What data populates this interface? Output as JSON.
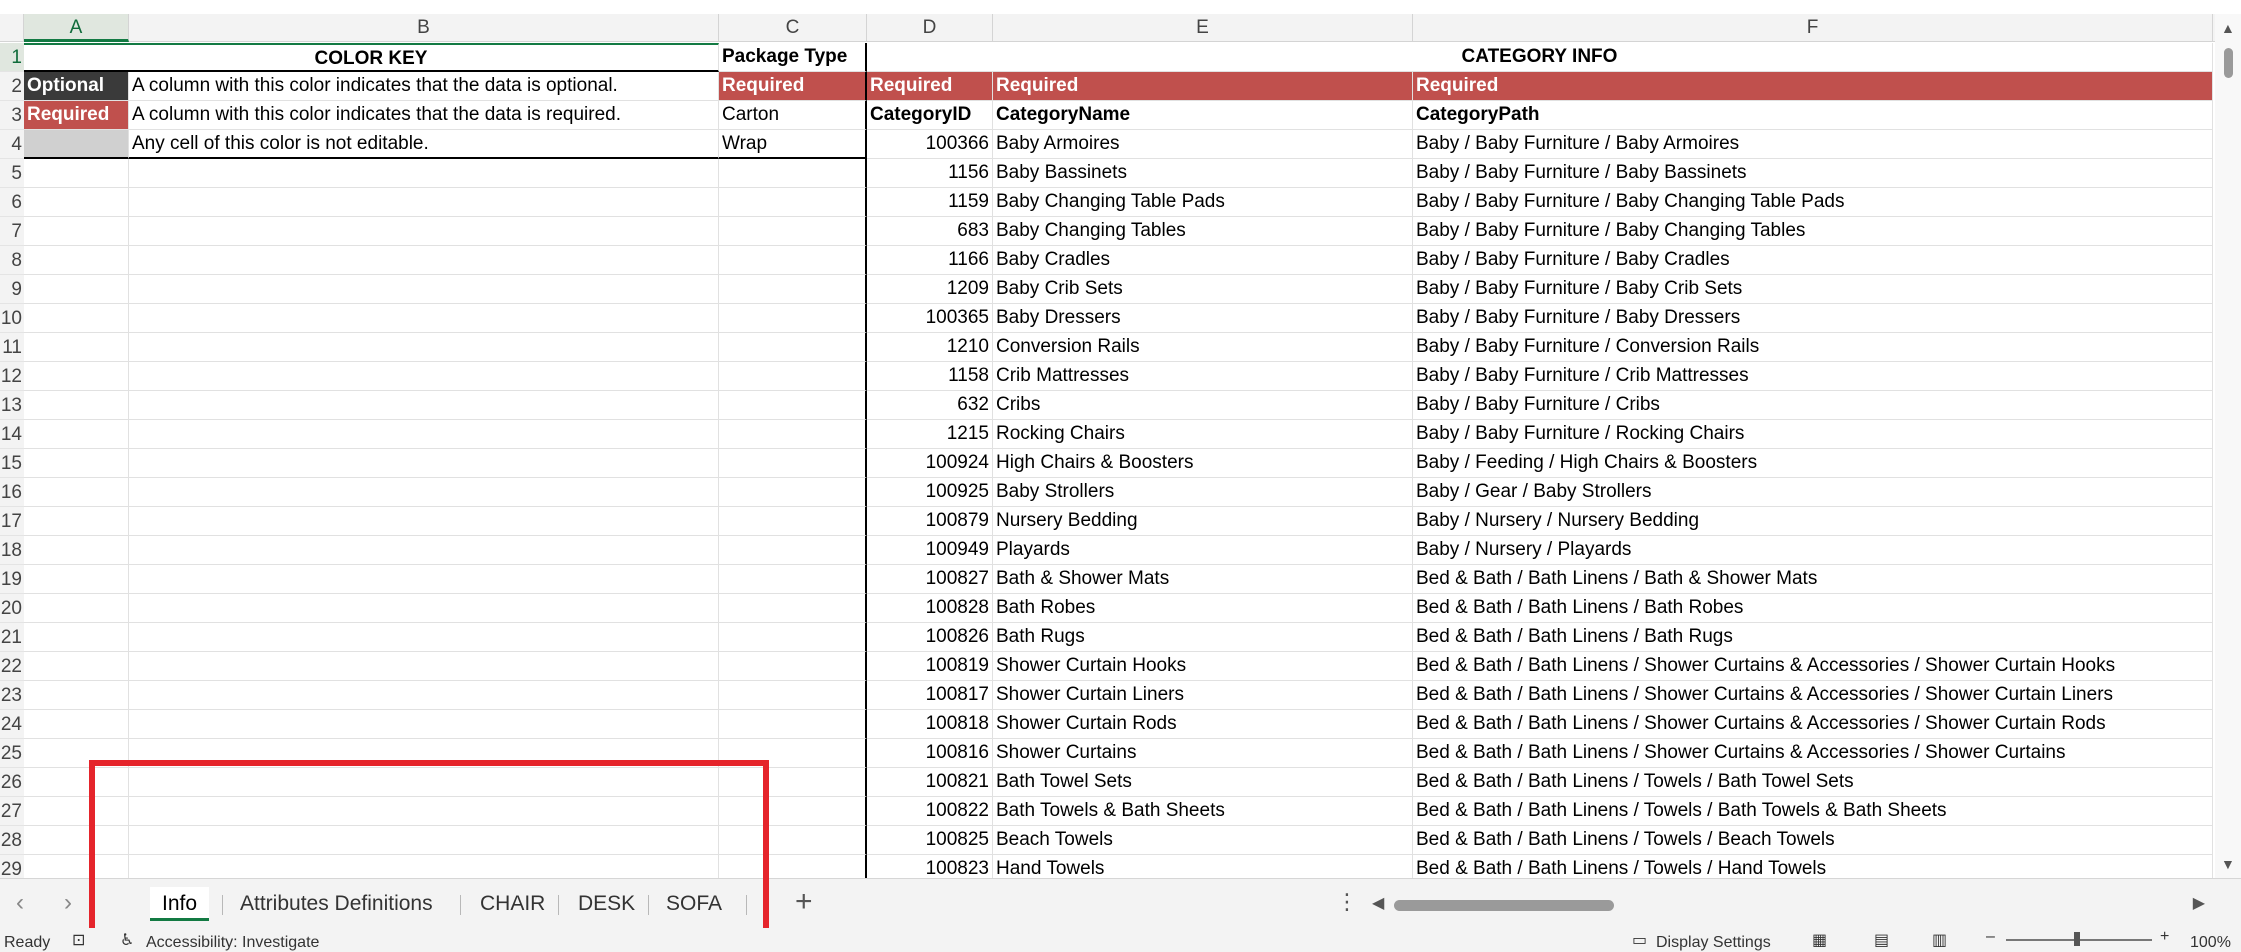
{
  "columns": [
    {
      "letter": "A",
      "left": 0,
      "width": 105
    },
    {
      "letter": "B",
      "left": 0,
      "width": 0
    }
  ],
  "col_headers": [
    "A",
    "B",
    "C",
    "D",
    "E",
    "F"
  ],
  "row_numbers": [
    "1",
    "2",
    "3",
    "4",
    "5",
    "6",
    "7",
    "8",
    "9",
    "10",
    "11",
    "12",
    "13",
    "14",
    "15",
    "16",
    "17",
    "18",
    "19",
    "20",
    "21",
    "22",
    "23",
    "24",
    "25",
    "26",
    "27",
    "28",
    "29"
  ],
  "color_key": {
    "title": "COLOR KEY",
    "optional_label": "Optional",
    "optional_desc": "A column  with this color indicates that the data is optional.",
    "required_label": "Required",
    "required_desc": "A column with this color indicates that the data is required.",
    "grey_desc": "Any cell of this color is not editable."
  },
  "package": {
    "title": "Package Type",
    "required_label": "Required",
    "values": [
      "Carton",
      "Wrap"
    ]
  },
  "category_info": {
    "title": "CATEGORY INFO",
    "required_label": "Required",
    "headers": [
      "CategoryID",
      "CategoryName",
      "CategoryPath"
    ],
    "rows": [
      [
        "100366",
        "Baby Armoires",
        "Baby / Baby Furniture / Baby Armoires"
      ],
      [
        "1156",
        "Baby Bassinets",
        "Baby / Baby Furniture / Baby Bassinets"
      ],
      [
        "1159",
        "Baby Changing Table Pads",
        "Baby / Baby Furniture / Baby Changing Table Pads"
      ],
      [
        "683",
        "Baby Changing Tables",
        "Baby / Baby Furniture / Baby Changing Tables"
      ],
      [
        "1166",
        "Baby Cradles",
        "Baby / Baby Furniture / Baby Cradles"
      ],
      [
        "1209",
        "Baby Crib Sets",
        "Baby / Baby Furniture / Baby Crib Sets"
      ],
      [
        "100365",
        "Baby Dressers",
        "Baby / Baby Furniture / Baby Dressers"
      ],
      [
        "1210",
        "Conversion Rails",
        "Baby / Baby Furniture / Conversion Rails"
      ],
      [
        "1158",
        "Crib Mattresses",
        "Baby / Baby Furniture / Crib Mattresses"
      ],
      [
        "632",
        "Cribs",
        "Baby / Baby Furniture / Cribs"
      ],
      [
        "1215",
        "Rocking Chairs",
        "Baby / Baby Furniture / Rocking Chairs"
      ],
      [
        "100924",
        "High Chairs & Boosters",
        "Baby / Feeding / High Chairs & Boosters"
      ],
      [
        "100925",
        "Baby Strollers",
        "Baby / Gear / Baby Strollers"
      ],
      [
        "100879",
        "Nursery Bedding",
        "Baby / Nursery / Nursery Bedding"
      ],
      [
        "100949",
        "Playards",
        "Baby / Nursery / Playards"
      ],
      [
        "100827",
        "Bath & Shower Mats",
        "Bed & Bath / Bath Linens / Bath & Shower Mats"
      ],
      [
        "100828",
        "Bath Robes",
        "Bed & Bath / Bath Linens / Bath Robes"
      ],
      [
        "100826",
        "Bath Rugs",
        "Bed & Bath / Bath Linens / Bath Rugs"
      ],
      [
        "100819",
        "Shower Curtain Hooks",
        "Bed & Bath / Bath Linens / Shower Curtains & Accessories / Shower Curtain Hooks"
      ],
      [
        "100817",
        "Shower Curtain Liners",
        "Bed & Bath / Bath Linens / Shower Curtains & Accessories / Shower Curtain Liners"
      ],
      [
        "100818",
        "Shower Curtain Rods",
        "Bed & Bath / Bath Linens / Shower Curtains & Accessories / Shower Curtain Rods"
      ],
      [
        "100816",
        "Shower Curtains",
        "Bed & Bath / Bath Linens / Shower Curtains & Accessories / Shower Curtains"
      ],
      [
        "100821",
        "Bath Towel Sets",
        "Bed & Bath / Bath Linens / Towels / Bath Towel Sets"
      ],
      [
        "100822",
        "Bath Towels & Bath Sheets",
        "Bed & Bath / Bath Linens / Towels / Bath Towels & Bath Sheets"
      ],
      [
        "100825",
        "Beach Towels",
        "Bed & Bath / Bath Linens / Towels / Beach Towels"
      ],
      [
        "100823",
        "Hand Towels",
        "Bed & Bath / Bath Linens / Towels / Hand Towels"
      ]
    ]
  },
  "sheet_tabs": {
    "active": "Info",
    "tabs": [
      "Info",
      "Attributes Definitions",
      "CHAIR",
      "DESK",
      "SOFA"
    ],
    "add_label": "+",
    "more_label": "⋮"
  },
  "status_bar": {
    "ready": "Ready",
    "accessibility": "Accessibility: Investigate",
    "display_settings": "Display Settings",
    "zoom": "100%"
  },
  "colors": {
    "optional": "#3a3a3a",
    "required": "#c0504d",
    "not_editable": "#d0d0d0",
    "active_green": "#137a43",
    "highlight": "#e5242b"
  }
}
